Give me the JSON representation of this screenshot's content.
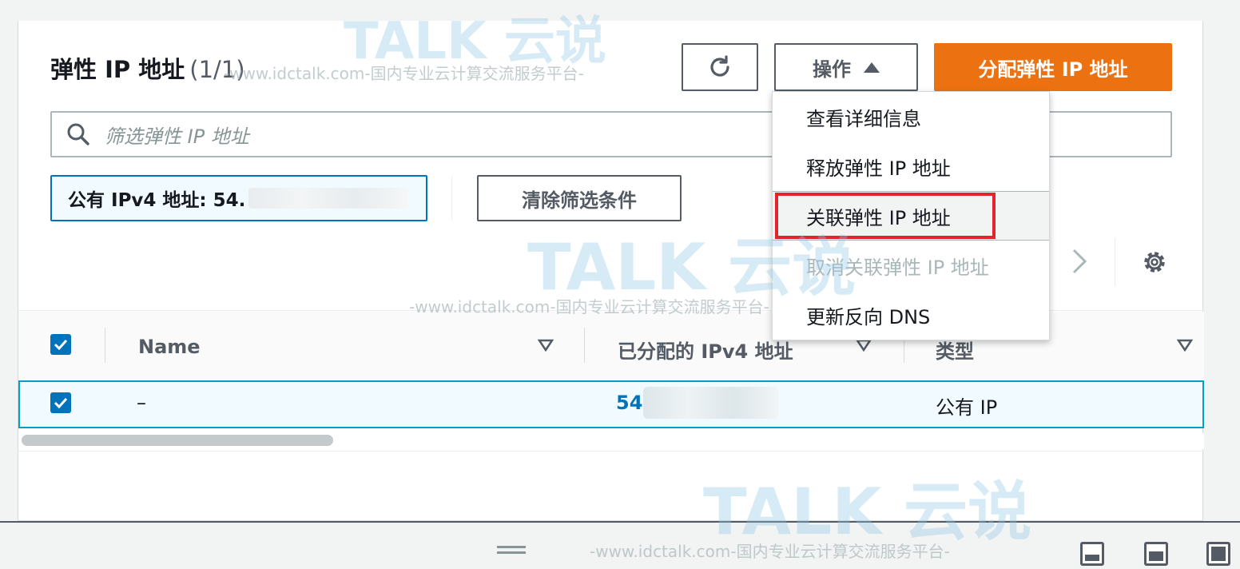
{
  "header": {
    "title": "弹性 IP 地址",
    "count": "(1/1)",
    "actions_label": "操作",
    "allocate_label": "分配弹性 IP 地址"
  },
  "search": {
    "placeholder": "筛选弹性 IP 地址"
  },
  "filter": {
    "token_label": "公有 IPv4 地址: 54.",
    "clear_label": "清除筛选条件"
  },
  "actions_menu": {
    "items": [
      {
        "label": "查看详细信息",
        "enabled": true
      },
      {
        "label": "释放弹性 IP 地址",
        "enabled": true
      },
      {
        "label": "关联弹性 IP 地址",
        "enabled": true,
        "highlighted": true
      },
      {
        "label": "取消关联弹性 IP 地址",
        "enabled": false
      },
      {
        "label": "更新反向 DNS",
        "enabled": true
      }
    ]
  },
  "table": {
    "columns": [
      "Name",
      "已分配的 IPv4 地址",
      "类型"
    ],
    "rows": [
      {
        "name": "–",
        "ipv4": "54",
        "type": "公有 IP",
        "selected": true
      }
    ]
  },
  "watermark": {
    "logo": "TALK 云说",
    "sub": "-www.idctalk.com-国内专业云计算交流服务平台-"
  },
  "colors": {
    "primary": "#ec7211",
    "link": "#0073bb",
    "highlight": "#e3242b"
  }
}
